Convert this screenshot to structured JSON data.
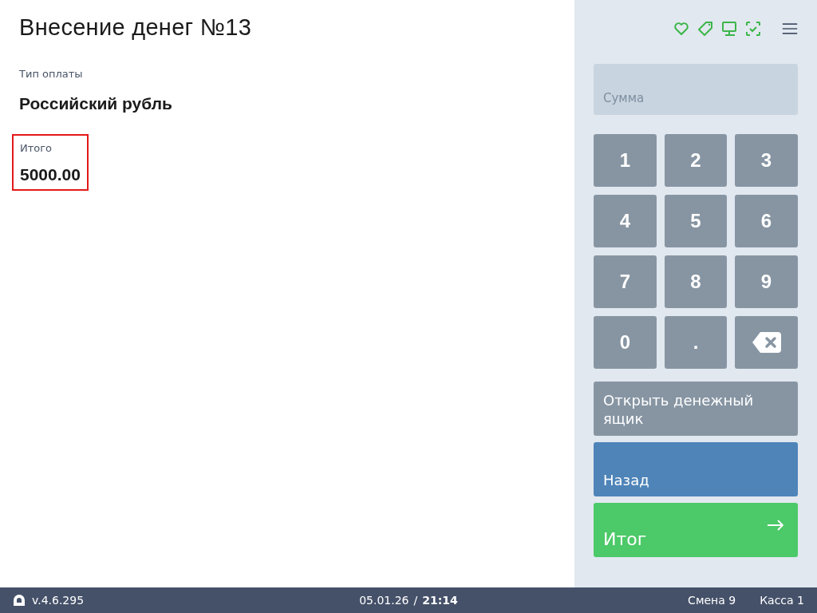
{
  "title": "Внесение денег №13",
  "payment_type": {
    "label": "Тип оплаты",
    "value": "Российский рубль"
  },
  "total": {
    "label": "Итого",
    "value": "5000.00",
    "highlighted": true
  },
  "amount_field": {
    "placeholder": "Сумма"
  },
  "keypad": [
    {
      "kind": "digit",
      "label": "1"
    },
    {
      "kind": "digit",
      "label": "2"
    },
    {
      "kind": "digit",
      "label": "3"
    },
    {
      "kind": "digit",
      "label": "4"
    },
    {
      "kind": "digit",
      "label": "5"
    },
    {
      "kind": "digit",
      "label": "6"
    },
    {
      "kind": "digit",
      "label": "7"
    },
    {
      "kind": "digit",
      "label": "8"
    },
    {
      "kind": "digit",
      "label": "9"
    },
    {
      "kind": "digit",
      "label": "0"
    },
    {
      "kind": "digit",
      "label": "."
    },
    {
      "kind": "backspace"
    }
  ],
  "actions": [
    {
      "kind": "secondary",
      "label": "Открыть денежный ящик"
    },
    {
      "kind": "back",
      "label": "Назад"
    },
    {
      "kind": "primary",
      "label": "Итог"
    }
  ],
  "status_bar": {
    "version": "v.4.6.295",
    "date": "05.01.26",
    "separator": "/",
    "time": "21:14",
    "shift": "Смена 9",
    "register": "Касса 1"
  }
}
